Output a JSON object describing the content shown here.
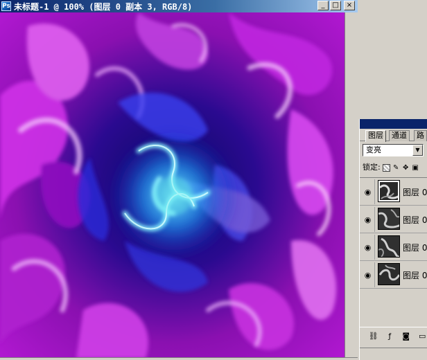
{
  "window": {
    "title": "未标题-1 @ 100% (图层 0 副本 3, RGB/8)",
    "buttons": {
      "minimize": "_",
      "maximize": "□",
      "close": "×"
    }
  },
  "layers_panel": {
    "tabs": [
      "图层",
      "通道",
      "路"
    ],
    "blend_mode": "变亮",
    "lock_label": "锁定:",
    "layers": [
      {
        "name": "图层 0",
        "visible": true,
        "selected": true
      },
      {
        "name": "图层 0",
        "visible": true,
        "selected": false
      },
      {
        "name": "图层 0",
        "visible": true,
        "selected": false
      },
      {
        "name": "图层 0",
        "visible": true,
        "selected": false
      }
    ],
    "footer_icons": [
      "link-icon",
      "style-icon",
      "mask-icon",
      "folder-icon"
    ]
  },
  "colors": {
    "titlebar": "#0a246a",
    "canvas_magenta": "#c020d8",
    "canvas_blue": "#1a1ad0",
    "canvas_cyan": "#40e0f0"
  }
}
